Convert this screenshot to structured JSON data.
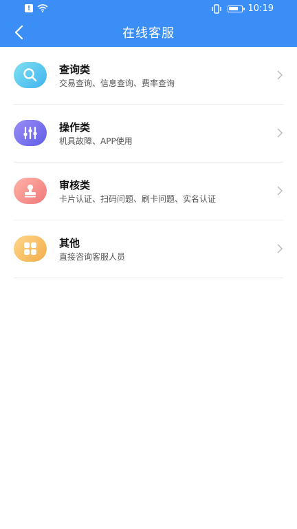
{
  "statusbar": {
    "time": "10:19",
    "alert_glyph": "!",
    "battery_level": 0.85
  },
  "header": {
    "title": "在线客服"
  },
  "items": [
    {
      "title": "查询类",
      "subtitle": "交易查询、信息查询、费率查询",
      "icon": "search-icon",
      "color_from": "#7fe0f0",
      "color_to": "#3fb3f0"
    },
    {
      "title": "操作类",
      "subtitle": "机具故障、APP使用",
      "icon": "sliders-icon",
      "color_from": "#9b8df5",
      "color_to": "#5e5ee6"
    },
    {
      "title": "审核类",
      "subtitle": "卡片认证、扫码问题、刷卡问题、实名认证",
      "icon": "stamp-icon",
      "color_from": "#ffb3a8",
      "color_to": "#f0787a"
    },
    {
      "title": "其他",
      "subtitle": "直接咨询客服人员",
      "icon": "grid-icon",
      "color_from": "#ffd68a",
      "color_to": "#f2ad4a"
    }
  ]
}
